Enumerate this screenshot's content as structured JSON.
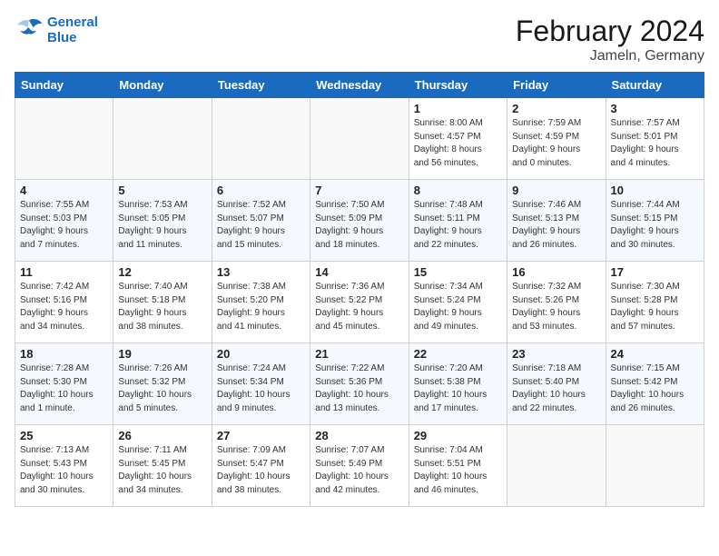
{
  "logo": {
    "line1": "General",
    "line2": "Blue"
  },
  "title": "February 2024",
  "location": "Jameln, Germany",
  "days_header": [
    "Sunday",
    "Monday",
    "Tuesday",
    "Wednesday",
    "Thursday",
    "Friday",
    "Saturday"
  ],
  "weeks": [
    [
      {
        "day": "",
        "info": ""
      },
      {
        "day": "",
        "info": ""
      },
      {
        "day": "",
        "info": ""
      },
      {
        "day": "",
        "info": ""
      },
      {
        "day": "1",
        "info": "Sunrise: 8:00 AM\nSunset: 4:57 PM\nDaylight: 8 hours\nand 56 minutes."
      },
      {
        "day": "2",
        "info": "Sunrise: 7:59 AM\nSunset: 4:59 PM\nDaylight: 9 hours\nand 0 minutes."
      },
      {
        "day": "3",
        "info": "Sunrise: 7:57 AM\nSunset: 5:01 PM\nDaylight: 9 hours\nand 4 minutes."
      }
    ],
    [
      {
        "day": "4",
        "info": "Sunrise: 7:55 AM\nSunset: 5:03 PM\nDaylight: 9 hours\nand 7 minutes."
      },
      {
        "day": "5",
        "info": "Sunrise: 7:53 AM\nSunset: 5:05 PM\nDaylight: 9 hours\nand 11 minutes."
      },
      {
        "day": "6",
        "info": "Sunrise: 7:52 AM\nSunset: 5:07 PM\nDaylight: 9 hours\nand 15 minutes."
      },
      {
        "day": "7",
        "info": "Sunrise: 7:50 AM\nSunset: 5:09 PM\nDaylight: 9 hours\nand 18 minutes."
      },
      {
        "day": "8",
        "info": "Sunrise: 7:48 AM\nSunset: 5:11 PM\nDaylight: 9 hours\nand 22 minutes."
      },
      {
        "day": "9",
        "info": "Sunrise: 7:46 AM\nSunset: 5:13 PM\nDaylight: 9 hours\nand 26 minutes."
      },
      {
        "day": "10",
        "info": "Sunrise: 7:44 AM\nSunset: 5:15 PM\nDaylight: 9 hours\nand 30 minutes."
      }
    ],
    [
      {
        "day": "11",
        "info": "Sunrise: 7:42 AM\nSunset: 5:16 PM\nDaylight: 9 hours\nand 34 minutes."
      },
      {
        "day": "12",
        "info": "Sunrise: 7:40 AM\nSunset: 5:18 PM\nDaylight: 9 hours\nand 38 minutes."
      },
      {
        "day": "13",
        "info": "Sunrise: 7:38 AM\nSunset: 5:20 PM\nDaylight: 9 hours\nand 41 minutes."
      },
      {
        "day": "14",
        "info": "Sunrise: 7:36 AM\nSunset: 5:22 PM\nDaylight: 9 hours\nand 45 minutes."
      },
      {
        "day": "15",
        "info": "Sunrise: 7:34 AM\nSunset: 5:24 PM\nDaylight: 9 hours\nand 49 minutes."
      },
      {
        "day": "16",
        "info": "Sunrise: 7:32 AM\nSunset: 5:26 PM\nDaylight: 9 hours\nand 53 minutes."
      },
      {
        "day": "17",
        "info": "Sunrise: 7:30 AM\nSunset: 5:28 PM\nDaylight: 9 hours\nand 57 minutes."
      }
    ],
    [
      {
        "day": "18",
        "info": "Sunrise: 7:28 AM\nSunset: 5:30 PM\nDaylight: 10 hours\nand 1 minute."
      },
      {
        "day": "19",
        "info": "Sunrise: 7:26 AM\nSunset: 5:32 PM\nDaylight: 10 hours\nand 5 minutes."
      },
      {
        "day": "20",
        "info": "Sunrise: 7:24 AM\nSunset: 5:34 PM\nDaylight: 10 hours\nand 9 minutes."
      },
      {
        "day": "21",
        "info": "Sunrise: 7:22 AM\nSunset: 5:36 PM\nDaylight: 10 hours\nand 13 minutes."
      },
      {
        "day": "22",
        "info": "Sunrise: 7:20 AM\nSunset: 5:38 PM\nDaylight: 10 hours\nand 17 minutes."
      },
      {
        "day": "23",
        "info": "Sunrise: 7:18 AM\nSunset: 5:40 PM\nDaylight: 10 hours\nand 22 minutes."
      },
      {
        "day": "24",
        "info": "Sunrise: 7:15 AM\nSunset: 5:42 PM\nDaylight: 10 hours\nand 26 minutes."
      }
    ],
    [
      {
        "day": "25",
        "info": "Sunrise: 7:13 AM\nSunset: 5:43 PM\nDaylight: 10 hours\nand 30 minutes."
      },
      {
        "day": "26",
        "info": "Sunrise: 7:11 AM\nSunset: 5:45 PM\nDaylight: 10 hours\nand 34 minutes."
      },
      {
        "day": "27",
        "info": "Sunrise: 7:09 AM\nSunset: 5:47 PM\nDaylight: 10 hours\nand 38 minutes."
      },
      {
        "day": "28",
        "info": "Sunrise: 7:07 AM\nSunset: 5:49 PM\nDaylight: 10 hours\nand 42 minutes."
      },
      {
        "day": "29",
        "info": "Sunrise: 7:04 AM\nSunset: 5:51 PM\nDaylight: 10 hours\nand 46 minutes."
      },
      {
        "day": "",
        "info": ""
      },
      {
        "day": "",
        "info": ""
      }
    ]
  ]
}
